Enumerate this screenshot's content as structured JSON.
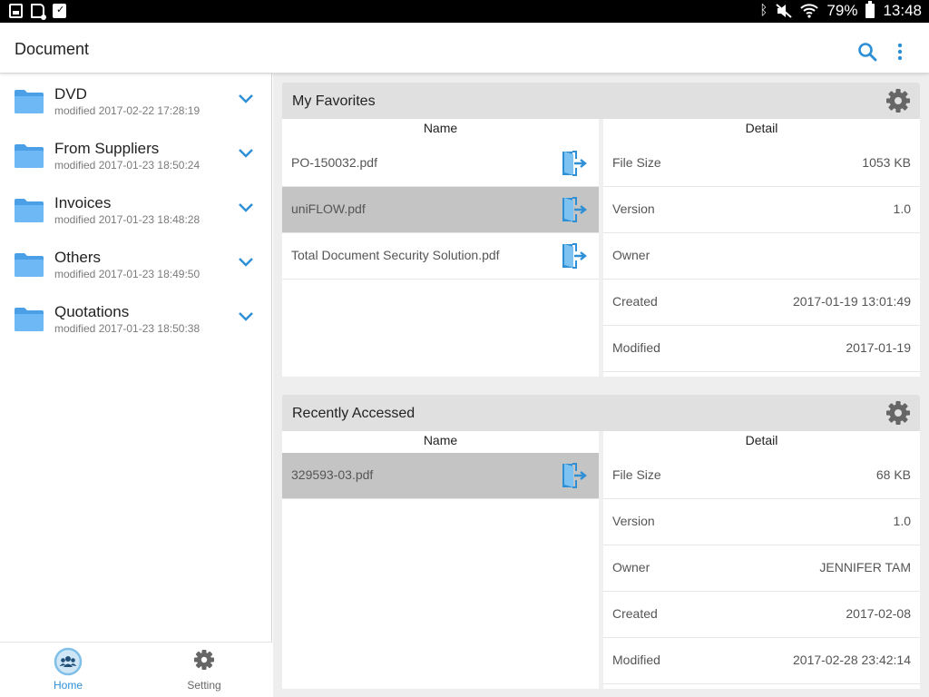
{
  "status_bar": {
    "battery": "79%",
    "time": "13:48"
  },
  "app_bar": {
    "title": "Document"
  },
  "folders": [
    {
      "name": "DVD",
      "modified": "modified 2017-02-22 17:28:19"
    },
    {
      "name": "From Suppliers",
      "modified": "modified 2017-01-23 18:50:24"
    },
    {
      "name": "Invoices",
      "modified": "modified 2017-01-23 18:48:28"
    },
    {
      "name": "Others",
      "modified": "modified 2017-01-23 18:49:50"
    },
    {
      "name": "Quotations",
      "modified": "modified 2017-01-23 18:50:38"
    }
  ],
  "bottom_nav": {
    "home": "Home",
    "setting": "Setting"
  },
  "favorites": {
    "title": "My Favorites",
    "name_header": "Name",
    "detail_header": "Detail",
    "files": [
      {
        "name": "PO-150032.pdf",
        "selected": false
      },
      {
        "name": "uniFLOW.pdf",
        "selected": true
      },
      {
        "name": "Total Document Security Solution.pdf",
        "selected": false
      }
    ],
    "details": [
      {
        "label": "File Size",
        "value": "1053 KB"
      },
      {
        "label": "Version",
        "value": "1.0"
      },
      {
        "label": "Owner",
        "value": ""
      },
      {
        "label": "Created",
        "value": "2017-01-19 13:01:49"
      },
      {
        "label": "Modified",
        "value": "2017-01-19"
      }
    ]
  },
  "recent": {
    "title": "Recently Accessed",
    "name_header": "Name",
    "detail_header": "Detail",
    "files": [
      {
        "name": "329593-03.pdf",
        "selected": true
      }
    ],
    "details": [
      {
        "label": "File Size",
        "value": "68 KB"
      },
      {
        "label": "Version",
        "value": "1.0"
      },
      {
        "label": "Owner",
        "value": "JENNIFER TAM"
      },
      {
        "label": "Created",
        "value": "2017-02-08"
      },
      {
        "label": "Modified",
        "value": "2017-02-28 23:42:14"
      }
    ]
  },
  "colors": {
    "accent": "#2d8fd6",
    "folder": "#5aaef0",
    "selected_row": "#c4c4c4",
    "card_header": "#e0e0e0"
  },
  "icons": {
    "search": "search-icon",
    "more": "more-vert-icon",
    "folder": "folder-icon",
    "expand": "chevron-down-icon",
    "gear": "gear-icon",
    "open": "open-file-icon",
    "home": "home-group-icon",
    "setting": "settings-icon"
  }
}
